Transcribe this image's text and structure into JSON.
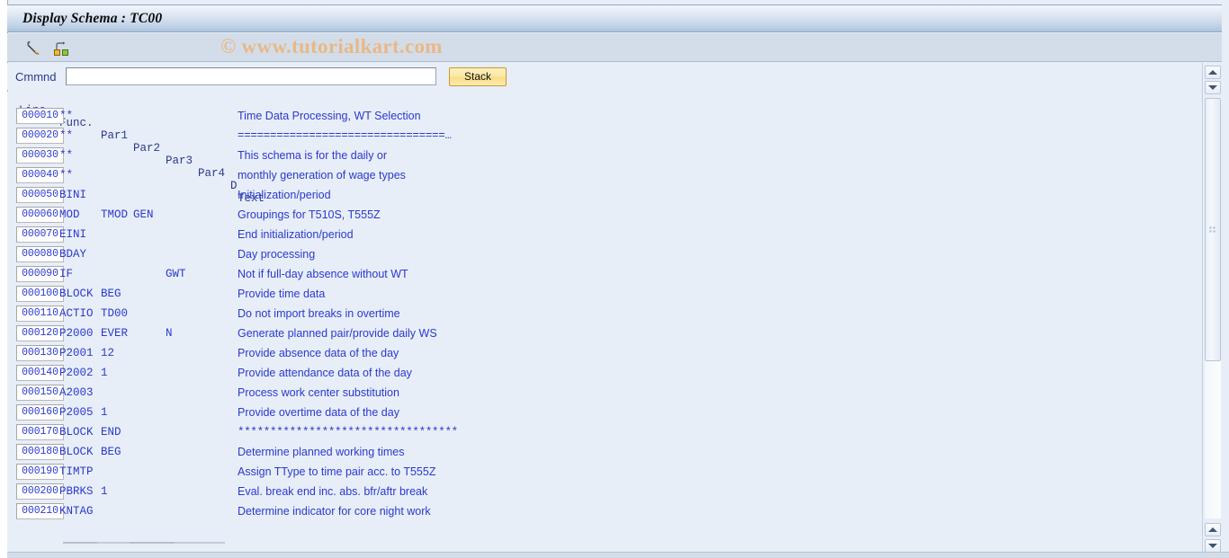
{
  "window": {
    "title": "Display Schema : TC00"
  },
  "watermark": "© www.tutorialkart.com",
  "toolbar": {
    "icons": [
      {
        "name": "edit-pencil-icon",
        "label": "Display <-> Change"
      },
      {
        "name": "object-structure-icon",
        "label": "Structure"
      }
    ]
  },
  "command": {
    "label": "Cmmnd",
    "value": "",
    "placeholder": "",
    "stack_label": "Stack"
  },
  "table": {
    "headers": {
      "line": "Line",
      "func": "Func.",
      "par1": "Par1",
      "par2": "Par2",
      "par3": "Par3",
      "par4": "Par4",
      "d": "D",
      "text": "Text"
    },
    "rows": [
      {
        "line": "000010",
        "func": "**",
        "par1": "",
        "par2": "",
        "par3": "",
        "par4": "",
        "d": "",
        "text": "Time Data Processing, WT Selection",
        "mono": false
      },
      {
        "line": "000020",
        "func": "**",
        "par1": "",
        "par2": "",
        "par3": "",
        "par4": "",
        "d": "",
        "text": "================================…",
        "mono": true
      },
      {
        "line": "000030",
        "func": "**",
        "par1": "",
        "par2": "",
        "par3": "",
        "par4": "",
        "d": "",
        "text": "This schema is for the daily or",
        "mono": false
      },
      {
        "line": "000040",
        "func": "**",
        "par1": "",
        "par2": "",
        "par3": "",
        "par4": "",
        "d": "",
        "text": "monthly generation of wage types",
        "mono": false
      },
      {
        "line": "000050",
        "func": "BINI",
        "par1": "",
        "par2": "",
        "par3": "",
        "par4": "",
        "d": "",
        "text": "Initialization/period",
        "mono": false
      },
      {
        "line": "000060",
        "func": "MOD",
        "par1": "TMOD",
        "par2": "GEN",
        "par3": "",
        "par4": "",
        "d": "",
        "text": "Groupings for T510S, T555Z",
        "mono": false
      },
      {
        "line": "000070",
        "func": "EINI",
        "par1": "",
        "par2": "",
        "par3": "",
        "par4": "",
        "d": "",
        "text": "End initialization/period",
        "mono": false
      },
      {
        "line": "000080",
        "func": "BDAY",
        "par1": "",
        "par2": "",
        "par3": "",
        "par4": "",
        "d": "",
        "text": "Day processing",
        "mono": false
      },
      {
        "line": "000090",
        "func": "IF",
        "par1": "",
        "par2": "",
        "par3": "GWT",
        "par4": "",
        "d": "",
        "text": "Not if full-day absence without WT",
        "mono": false
      },
      {
        "line": "000100",
        "func": "BLOCK",
        "par1": "BEG",
        "par2": "",
        "par3": "",
        "par4": "",
        "d": "",
        "text": "Provide time data",
        "mono": false
      },
      {
        "line": "000110",
        "func": "ACTIO",
        "par1": "TD00",
        "par2": "",
        "par3": "",
        "par4": "",
        "d": "",
        "text": "Do not import breaks in overtime",
        "mono": false
      },
      {
        "line": "000120",
        "func": "P2000",
        "par1": "EVER",
        "par2": "",
        "par3": "N",
        "par4": "",
        "d": "",
        "text": "Generate planned pair/provide daily WS",
        "mono": false
      },
      {
        "line": "000130",
        "func": "P2001",
        "par1": "12",
        "par2": "",
        "par3": "",
        "par4": "",
        "d": "",
        "text": "Provide absence data of the day",
        "mono": false
      },
      {
        "line": "000140",
        "func": "P2002",
        "par1": "1",
        "par2": "",
        "par3": "",
        "par4": "",
        "d": "",
        "text": "Provide attendance data of the day",
        "mono": false
      },
      {
        "line": "000150",
        "func": "A2003",
        "par1": "",
        "par2": "",
        "par3": "",
        "par4": "",
        "d": "",
        "text": "Process work center substitution",
        "mono": false
      },
      {
        "line": "000160",
        "func": "P2005",
        "par1": "1",
        "par2": "",
        "par3": "",
        "par4": "",
        "d": "",
        "text": "Provide overtime data of the day",
        "mono": false
      },
      {
        "line": "000170",
        "func": "BLOCK",
        "par1": "END",
        "par2": "",
        "par3": "",
        "par4": "",
        "d": "",
        "text": "**********************************",
        "mono": true
      },
      {
        "line": "000180",
        "func": "BLOCK",
        "par1": "BEG",
        "par2": "",
        "par3": "",
        "par4": "",
        "d": "",
        "text": "Determine planned working times",
        "mono": false
      },
      {
        "line": "000190",
        "func": "TIMTP",
        "par1": "",
        "par2": "",
        "par3": "",
        "par4": "",
        "d": "",
        "text": "Assign TType to time pair acc. to T555Z",
        "mono": false
      },
      {
        "line": "000200",
        "func": "PBRKS",
        "par1": "1",
        "par2": "",
        "par3": "",
        "par4": "",
        "d": "",
        "text": "Eval. break end inc. abs. bfr/aftr break",
        "mono": false
      },
      {
        "line": "000210",
        "func": "KNTAG",
        "par1": "",
        "par2": "",
        "par3": "",
        "par4": "",
        "d": "",
        "text": "Determine indicator for core night work",
        "mono": false
      }
    ]
  },
  "scrollbars": {
    "vertical": {
      "name": "vertical-scrollbar"
    },
    "horizontal": {
      "name": "horizontal-scrollbar"
    }
  },
  "colors": {
    "background": "#e8eef7",
    "title_gradient_top": "#f2f6fb",
    "title_gradient_bottom": "#aec3dd",
    "toolbar": "#d3dde9",
    "text_blue": "#2a39cf",
    "header_blue": "#2b3a8f",
    "watermark": "#e9b886",
    "button_yellow": "#fbe79f"
  }
}
